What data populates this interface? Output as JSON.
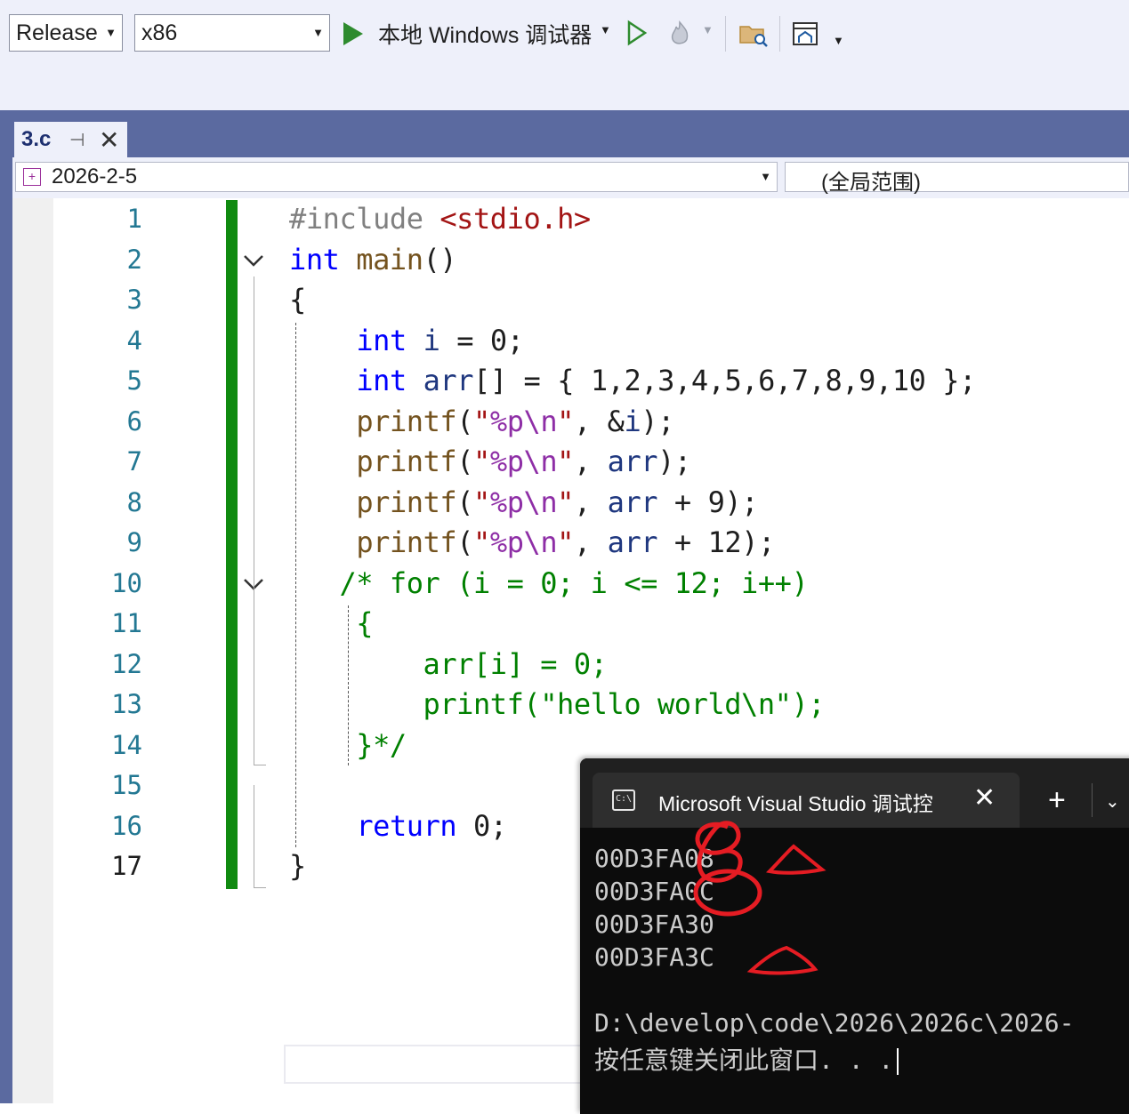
{
  "toolbar": {
    "config": "Release",
    "platform": "x86",
    "run_label": "本地 Windows 调试器"
  },
  "tab": {
    "name": "3.c",
    "pin": "⊣",
    "close": "✕"
  },
  "navbar": {
    "project": "2026-2-5",
    "scope": "(全局范围)"
  },
  "editor": {
    "line_numbers": [
      "1",
      "2",
      "3",
      "4",
      "5",
      "6",
      "7",
      "8",
      "9",
      "10",
      "11",
      "12",
      "13",
      "14",
      "15",
      "16",
      "17"
    ],
    "current_line": 17,
    "lines": [
      "#include <stdio.h>",
      "int main()",
      "{",
      "    int i = 0;",
      "    int arr[] = { 1,2,3,4,5,6,7,8,9,10 };",
      "    printf(\"%p\\n\", &i);",
      "    printf(\"%p\\n\", arr);",
      "    printf(\"%p\\n\", arr + 9);",
      "    printf(\"%p\\n\", arr + 12);",
      "   /* for (i = 0; i <= 12; i++)",
      "    {",
      "        arr[i] = 0;",
      "        printf(\"hello world\\n\");",
      "    }*/",
      "",
      "    return 0;",
      "}"
    ]
  },
  "console": {
    "title": "Microsoft Visual Studio 调试控",
    "close": "✕",
    "new_tab": "+",
    "output": [
      "00D3FA08",
      "00D3FA0C",
      "00D3FA30",
      "00D3FA3C",
      "",
      "D:\\develop\\code\\2026\\2026c\\2026-",
      "按任意键关闭此窗口. . ."
    ]
  },
  "colors": {
    "keyword": "#0000ff",
    "function": "#74531f",
    "string": "#a31515",
    "format": "#8e2ea6",
    "variable": "#1f377f",
    "comment": "#008000",
    "change_bar": "#108a10",
    "annotation": "#e51c23"
  }
}
